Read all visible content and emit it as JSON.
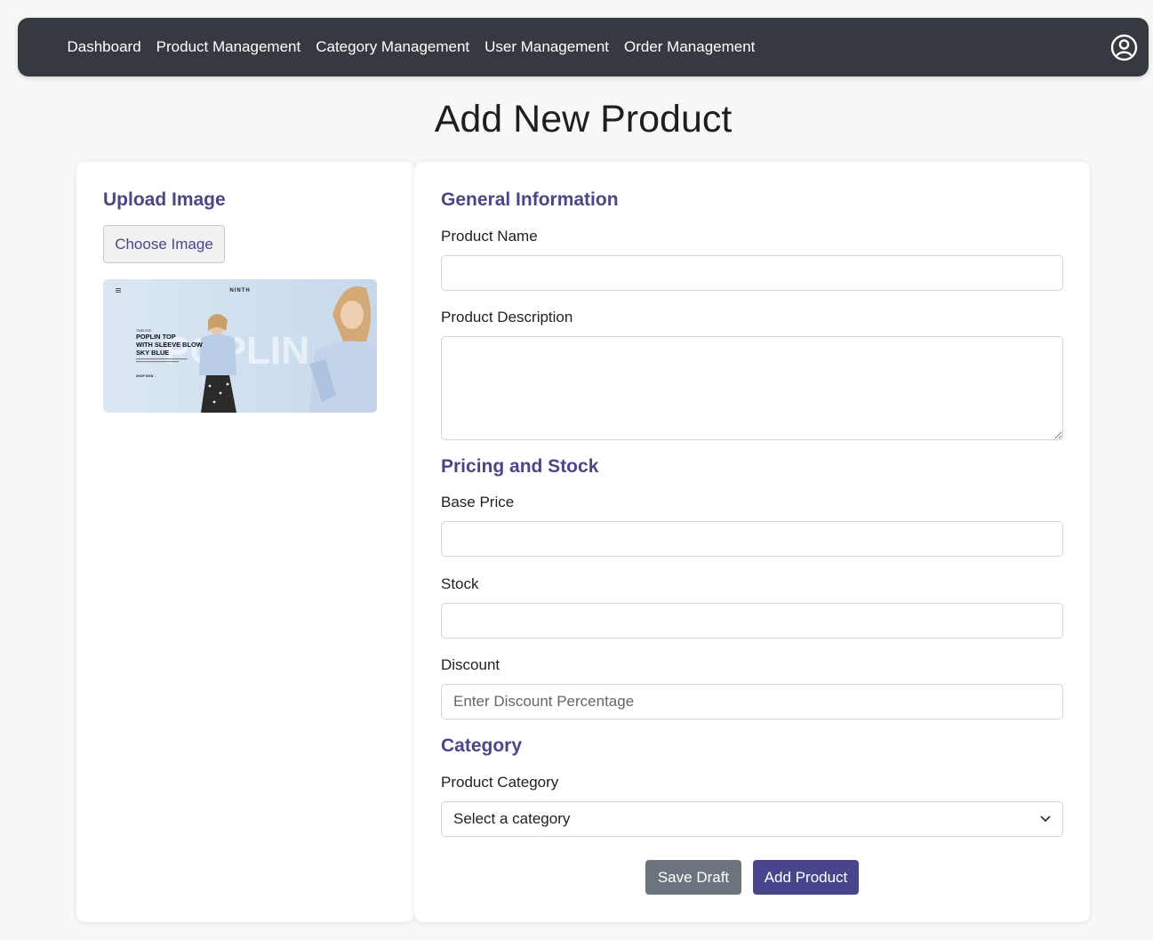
{
  "nav": {
    "items": [
      "Dashboard",
      "Product Management",
      "Category Management",
      "User Management",
      "Order Management"
    ],
    "user_icon": "user-circle-icon"
  },
  "page": {
    "title": "Add New Product"
  },
  "upload": {
    "title": "Upload Image",
    "choose_label": "Choose Image",
    "preview": {
      "brand": "NINTH",
      "kicker": "TIMELESS",
      "headline": [
        "POPLIN TOP",
        "WITH SLEEVE BLOW",
        "SKY BLUE"
      ],
      "watermark": "POPLIN",
      "cta": "SHOP NOW →"
    }
  },
  "general": {
    "title": "General Information",
    "name_label": "Product Name",
    "name_value": "",
    "description_label": "Product Description",
    "description_value": ""
  },
  "pricing": {
    "title": "Pricing and Stock",
    "base_price_label": "Base Price",
    "base_price_value": "",
    "stock_label": "Stock",
    "stock_value": "",
    "discount_label": "Discount",
    "discount_placeholder": "Enter Discount Percentage"
  },
  "category": {
    "title": "Category",
    "label": "Product Category",
    "selected": "Select a category"
  },
  "actions": {
    "save_draft": "Save Draft",
    "add_product": "Add Product"
  },
  "colors": {
    "navbar": "#343a40",
    "accent": "#4a4789",
    "primary_button": "#47468c",
    "secondary_button": "#6c757d"
  }
}
